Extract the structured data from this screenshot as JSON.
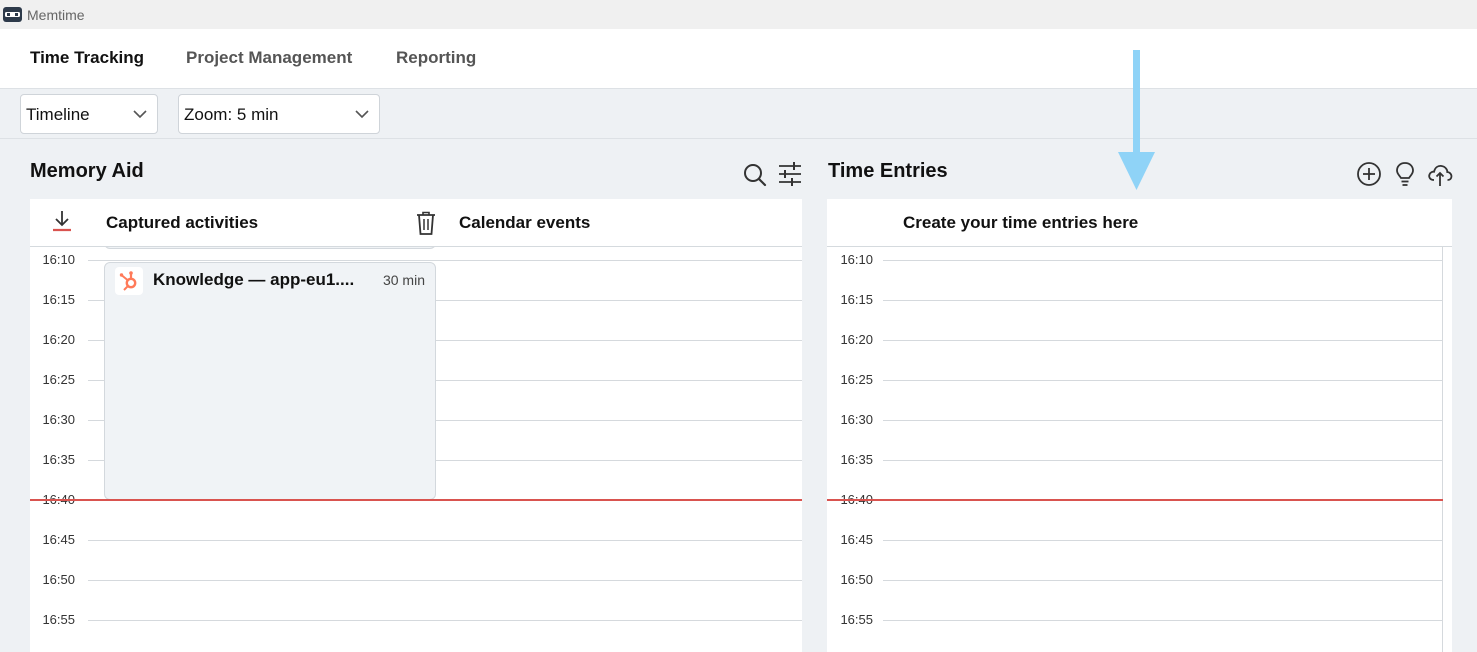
{
  "app": {
    "title": "Memtime"
  },
  "nav": {
    "tabs": [
      {
        "label": "Time Tracking",
        "active": true
      },
      {
        "label": "Project Management",
        "active": false
      },
      {
        "label": "Reporting",
        "active": false
      }
    ]
  },
  "toolbar": {
    "view_select": "Timeline",
    "zoom_select": "Zoom: 5 min"
  },
  "memory_aid": {
    "title": "Memory Aid",
    "captured_label": "Captured activities",
    "calendar_label": "Calendar events",
    "activity": {
      "title": "Knowledge — app-eu1....",
      "duration": "30 min"
    }
  },
  "time_entries": {
    "title": "Time Entries",
    "header_label": "Create your time entries here"
  },
  "timeline": {
    "times": [
      "16:10",
      "16:15",
      "16:20",
      "16:25",
      "16:30",
      "16:35",
      "16:40",
      "16:45",
      "16:50",
      "16:55"
    ],
    "now": "16:40"
  },
  "colors": {
    "accent_red": "#d9534f",
    "hubspot_orange": "#ff7a59",
    "arrow_blue": "#8fd3f7"
  }
}
